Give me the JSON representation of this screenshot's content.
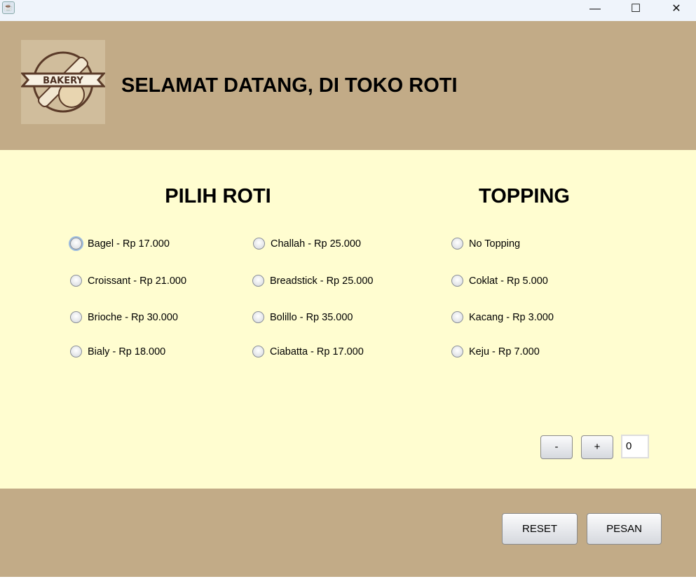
{
  "window": {
    "minimize": "—",
    "maximize": "☐",
    "close": "✕"
  },
  "header": {
    "logo_text": "BAKERY",
    "title": "SELAMAT DATANG, DI TOKO ROTI"
  },
  "roti": {
    "heading": "PILIH ROTI",
    "items": [
      "Bagel - Rp 17.000",
      "Croissant - Rp 21.000",
      "Brioche - Rp 30.000",
      "Bialy - Rp 18.000",
      "Challah - Rp 25.000",
      "Breadstick - Rp 25.000",
      "Bolillo - Rp 35.000",
      "Ciabatta - Rp 17.000"
    ]
  },
  "topping": {
    "heading": "TOPPING",
    "items": [
      "No Topping",
      "Coklat - Rp 5.000",
      "Kacang - Rp 3.000",
      "Keju - Rp 7.000"
    ]
  },
  "quantity": {
    "minus": "-",
    "plus": "+",
    "value": "0"
  },
  "footer": {
    "reset": "RESET",
    "pesan": "PESAN"
  }
}
